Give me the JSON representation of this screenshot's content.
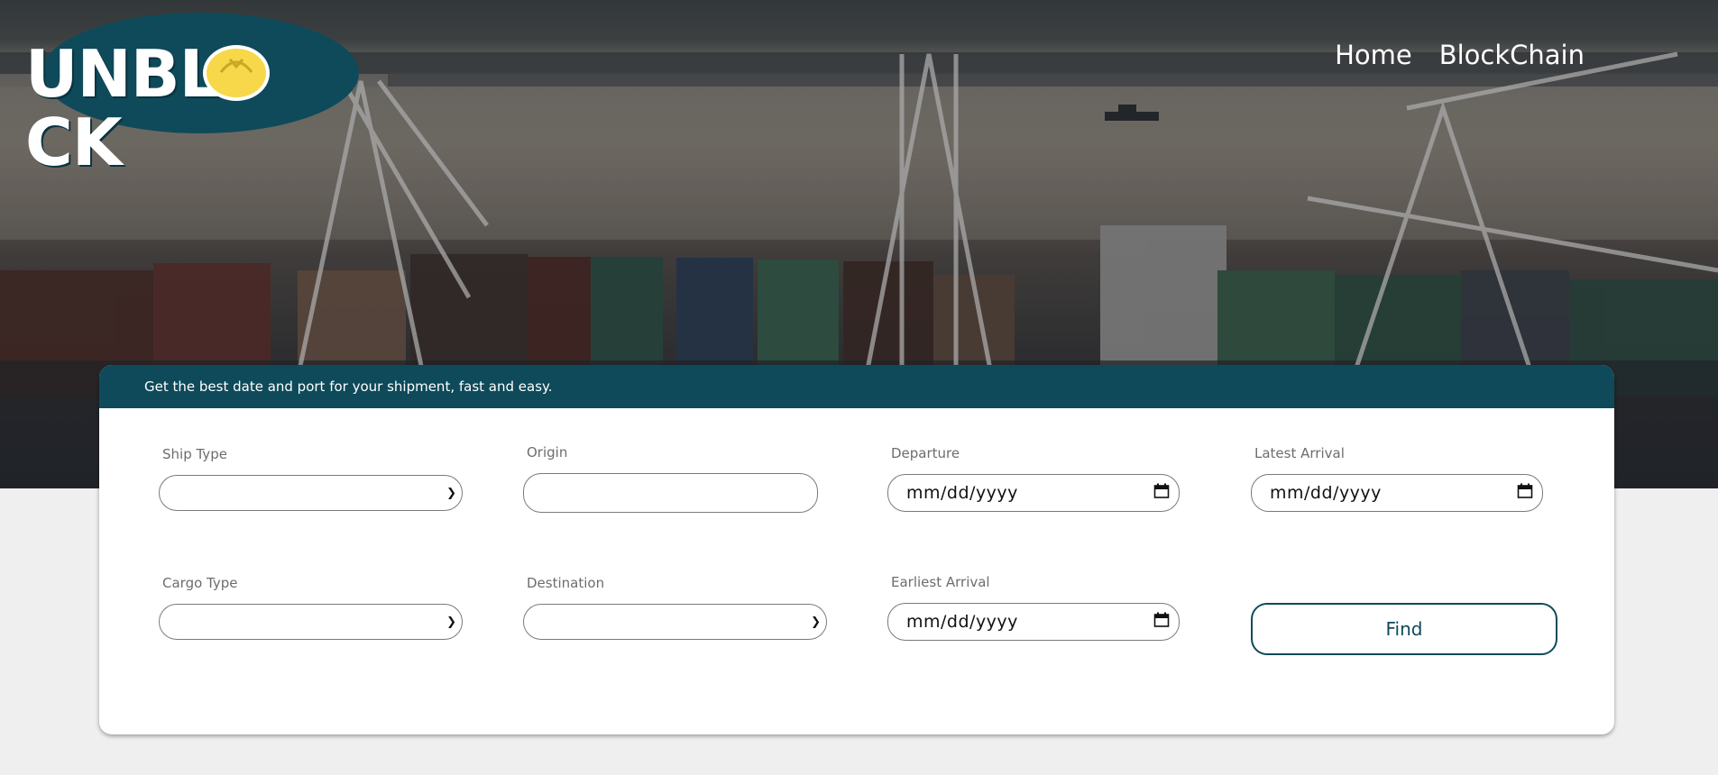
{
  "brand": {
    "logo_text_left": "UNBL",
    "logo_text_right": "CK"
  },
  "nav": {
    "items": [
      {
        "label": "Home"
      },
      {
        "label": "BlockChain"
      }
    ]
  },
  "search": {
    "tagline": "Get the best date and port for your shipment, fast and easy.",
    "fields": {
      "ship_type": {
        "label": "Ship Type",
        "value": ""
      },
      "origin": {
        "label": "Origin",
        "value": ""
      },
      "departure": {
        "label": "Departure",
        "value": "mm/dd/yyyy"
      },
      "latest_arrival": {
        "label": "Latest Arrival",
        "value": "mm/dd/yyyy"
      },
      "cargo_type": {
        "label": "Cargo Type",
        "value": ""
      },
      "destination": {
        "label": "Destination",
        "value": ""
      },
      "earliest_arrival": {
        "label": "Earliest Arrival",
        "value": "mm/dd/yyyy"
      }
    },
    "find_label": "Find"
  },
  "colors": {
    "brand": "#0e4a5a",
    "logo_accent": "#f6d84a",
    "page_bg": "#efefef"
  }
}
